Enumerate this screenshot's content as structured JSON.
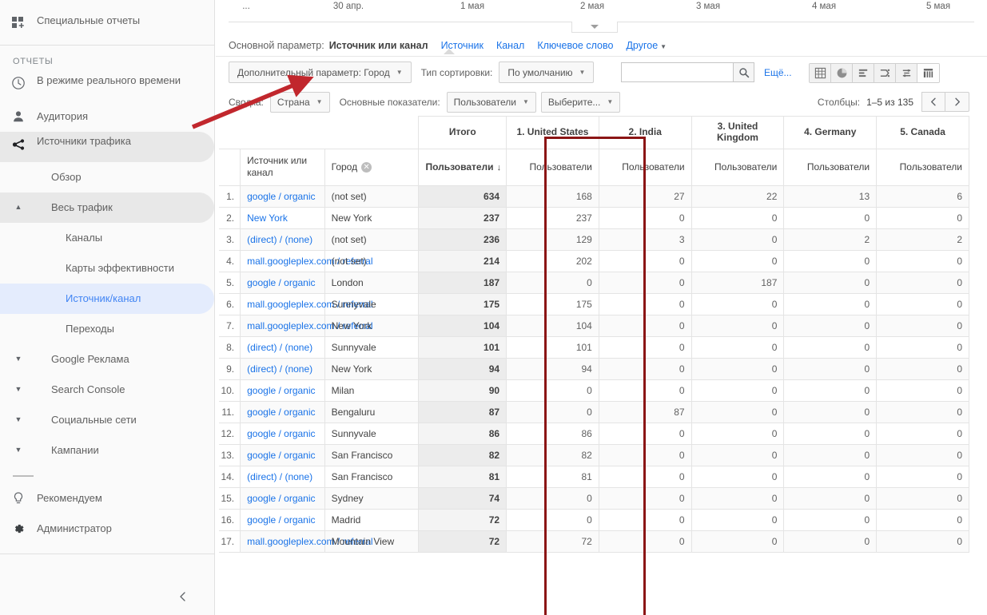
{
  "sidebar": {
    "top_item": {
      "label": "Специальные отчеты",
      "icon": "custom-reports-icon"
    },
    "section_label": "ОТЧЕТЫ",
    "items": [
      {
        "label": "В режиме реального времени",
        "icon": "clock-icon"
      },
      {
        "label": "Аудитория",
        "icon": "person-icon"
      },
      {
        "label": "Источники трафика",
        "icon": "traffic-sources-icon",
        "state": "selected-grey"
      }
    ],
    "sub_items": [
      {
        "label": "Обзор",
        "state": ""
      },
      {
        "label": "Весь трафик",
        "state": "selected-grey",
        "caret": "▲"
      },
      {
        "label": "Каналы",
        "state": "",
        "level": 3
      },
      {
        "label": "Карты эффективности",
        "state": "",
        "level": 3
      },
      {
        "label": "Источник/канал",
        "state": "selected-blue",
        "level": 3
      },
      {
        "label": "Переходы",
        "state": "",
        "level": 3
      },
      {
        "label": "Google Реклама",
        "state": "",
        "caret": "▼"
      },
      {
        "label": "Search Console",
        "state": "",
        "caret": "▼"
      },
      {
        "label": "Социальные сети",
        "state": "",
        "caret": "▼"
      },
      {
        "label": "Кампании",
        "state": "",
        "caret": "▼"
      }
    ],
    "footer_items": [
      {
        "label": "Рекомендуем",
        "icon": "lightbulb-icon"
      },
      {
        "label": "Администратор",
        "icon": "gear-icon"
      }
    ],
    "collapse_icon": "chevron-left-icon"
  },
  "date_axis": {
    "ticks": [
      "...",
      "30 апр.",
      "1 мая",
      "2 мая",
      "3 мая",
      "4 мая",
      "5 мая"
    ],
    "handle_icon": "chevron-down-icon"
  },
  "primary_dimension": {
    "label": "Основной параметр:",
    "active": "Источник или канал",
    "links": [
      "Источник",
      "Канал",
      "Ключевое слово"
    ],
    "more": "Другое"
  },
  "toolbar": {
    "secondary_dimension_button": "Дополнительный параметр: Город",
    "sort_type_label": "Тип сортировки:",
    "sort_type_value": "По умолчанию",
    "search_value": "",
    "search_placeholder": "",
    "search_icon": "search-icon",
    "more_link": "Ещё...",
    "view_icons": [
      "table-view-icon",
      "pie-chart-view-icon",
      "performance-view-icon",
      "comparison-view-icon",
      "term-cloud-view-icon",
      "pivot-view-icon"
    ],
    "selected_view_index": 5
  },
  "pivot_controls": {
    "summary_label": "Сводка:",
    "summary_value": "Страна",
    "metrics_label": "Основные показатели:",
    "metric_value": "Пользователи",
    "metric_secondary": "Выберите...",
    "columns_label": "Столбцы:",
    "columns_range": "1–5 из 135",
    "prev_icon": "chevron-left-icon",
    "next_icon": "chevron-right-icon"
  },
  "table": {
    "group_headers": [
      "Итого",
      "1. United States",
      "2. India",
      "3. United Kingdom",
      "4. Germany",
      "5. Canada"
    ],
    "dimension_headers": [
      "Источник или канал",
      "Город"
    ],
    "city_remove_icon": "remove-icon",
    "metric_header": "Пользователи",
    "sort_arrow": "↓",
    "rows": [
      {
        "n": "1.",
        "source": "google / organic",
        "city": "(not set)",
        "total": "634",
        "values": [
          "168",
          "27",
          "22",
          "13",
          "6"
        ]
      },
      {
        "n": "2.",
        "source": "New York",
        "city": "New York",
        "total": "237",
        "values": [
          "237",
          "0",
          "0",
          "0",
          "0"
        ]
      },
      {
        "n": "3.",
        "source": "(direct) / (none)",
        "city": "(not set)",
        "total": "236",
        "values": [
          "129",
          "3",
          "0",
          "2",
          "2"
        ]
      },
      {
        "n": "4.",
        "source": "mall.googleplex.com / referral",
        "city": "(not set)",
        "total": "214",
        "values": [
          "202",
          "0",
          "0",
          "0",
          "0"
        ]
      },
      {
        "n": "5.",
        "source": "google / organic",
        "city": "London",
        "total": "187",
        "values": [
          "0",
          "0",
          "187",
          "0",
          "0"
        ]
      },
      {
        "n": "6.",
        "source": "mall.googleplex.com / referral",
        "city": "Sunnyvale",
        "total": "175",
        "values": [
          "175",
          "0",
          "0",
          "0",
          "0"
        ]
      },
      {
        "n": "7.",
        "source": "mall.googleplex.com / referral",
        "city": "New York",
        "total": "104",
        "values": [
          "104",
          "0",
          "0",
          "0",
          "0"
        ]
      },
      {
        "n": "8.",
        "source": "(direct) / (none)",
        "city": "Sunnyvale",
        "total": "101",
        "values": [
          "101",
          "0",
          "0",
          "0",
          "0"
        ]
      },
      {
        "n": "9.",
        "source": "(direct) / (none)",
        "city": "New York",
        "total": "94",
        "values": [
          "94",
          "0",
          "0",
          "0",
          "0"
        ]
      },
      {
        "n": "10.",
        "source": "google / organic",
        "city": "Milan",
        "total": "90",
        "values": [
          "0",
          "0",
          "0",
          "0",
          "0"
        ]
      },
      {
        "n": "11.",
        "source": "google / organic",
        "city": "Bengaluru",
        "total": "87",
        "values": [
          "0",
          "87",
          "0",
          "0",
          "0"
        ]
      },
      {
        "n": "12.",
        "source": "google / organic",
        "city": "Sunnyvale",
        "total": "86",
        "values": [
          "86",
          "0",
          "0",
          "0",
          "0"
        ]
      },
      {
        "n": "13.",
        "source": "google / organic",
        "city": "San Francisco",
        "total": "82",
        "values": [
          "82",
          "0",
          "0",
          "0",
          "0"
        ]
      },
      {
        "n": "14.",
        "source": "(direct) / (none)",
        "city": "San Francisco",
        "total": "81",
        "values": [
          "81",
          "0",
          "0",
          "0",
          "0"
        ]
      },
      {
        "n": "15.",
        "source": "google / organic",
        "city": "Sydney",
        "total": "74",
        "values": [
          "0",
          "0",
          "0",
          "0",
          "0"
        ]
      },
      {
        "n": "16.",
        "source": "google / organic",
        "city": "Madrid",
        "total": "72",
        "values": [
          "0",
          "0",
          "0",
          "0",
          "0"
        ]
      },
      {
        "n": "17.",
        "source": "mall.googleplex.com / referral",
        "city": "Mountain View",
        "total": "72",
        "values": [
          "72",
          "0",
          "0",
          "0",
          "0"
        ]
      }
    ]
  },
  "annotations": {
    "highlight_color": "#8b1515",
    "rect_target": "Город",
    "arrow_target": "Дополнительный параметр: Город"
  }
}
